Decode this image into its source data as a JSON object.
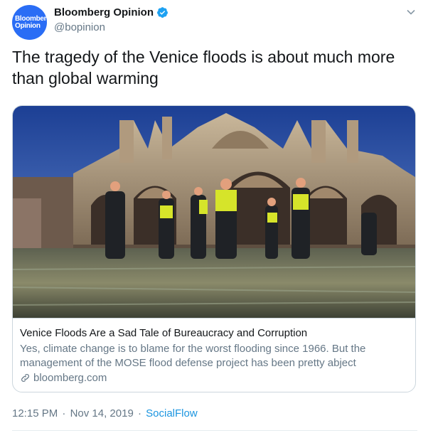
{
  "author": {
    "avatar_line1": "Bloomberg",
    "avatar_line2": "Opinion",
    "display_name": "Bloomberg Opinion",
    "handle": "@bopinion",
    "verified": true
  },
  "tweet": {
    "text": "The tragedy of the Venice floods is about much more than global warming"
  },
  "card": {
    "image_icon": "venice-flood-photo",
    "title": "Venice Floods Are a Sad Tale of Bureaucracy and Corruption",
    "description": "Yes, climate change is to blame for the worst flooding since 1966. But the management of the MOSE flood defense project has been pretty abject",
    "domain": "bloomberg.com"
  },
  "meta": {
    "time": "12:15 PM",
    "separator": "·",
    "date": "Nov 14, 2019",
    "separator2": "·",
    "source": "SocialFlow"
  },
  "colors": {
    "brand_blue": "#2a6df5",
    "link_blue": "#1b95e0",
    "text_primary": "#14171a",
    "text_secondary": "#657786",
    "border": "#ccd6dd"
  }
}
